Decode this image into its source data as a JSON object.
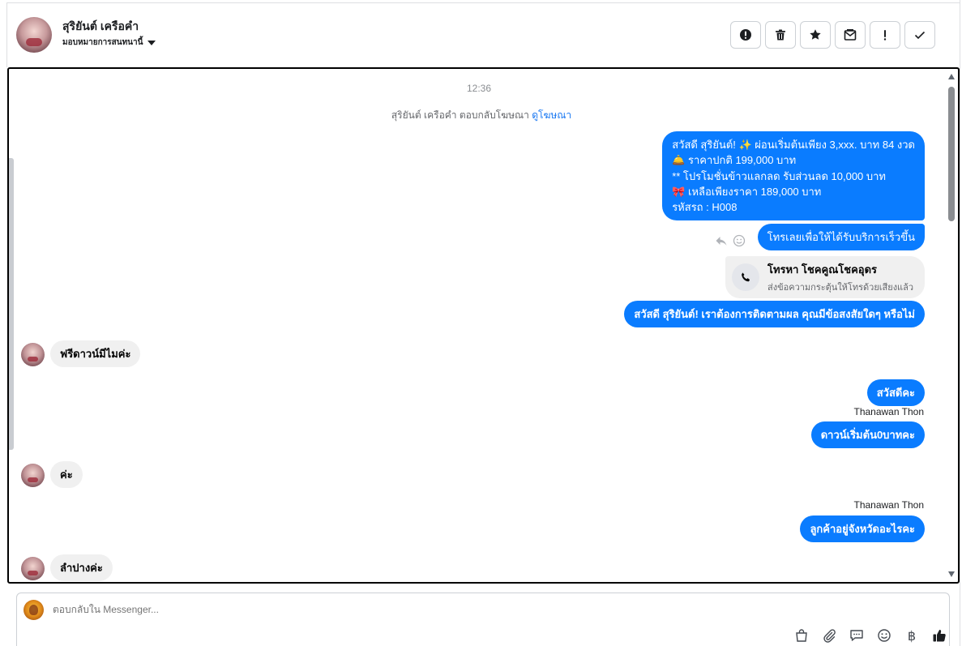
{
  "header": {
    "contact_name": "สุริยันต์ เครือคำ",
    "assign_label": "มอบหมายการสนทนานี้",
    "actions": [
      {
        "icon": "alert-circle-icon",
        "label": "spam"
      },
      {
        "icon": "trash-icon",
        "label": "delete"
      },
      {
        "icon": "star-icon",
        "label": "star"
      },
      {
        "icon": "mark-unread-icon",
        "label": "unread"
      },
      {
        "icon": "exclamation-icon",
        "label": "follow-up"
      },
      {
        "icon": "check-icon",
        "label": "done"
      }
    ]
  },
  "conversation": {
    "timestamp": "12:36",
    "ad_reply_text": "สุริยันต์ เครือคำ ตอบกลับโฆษณา",
    "ad_reply_link": "ดูโฆษณา",
    "promo_lines": [
      "สวัสดี สุริยันต์! ✨  ผ่อนเริ่มต้นเพียง 3,xxx. บาท 84 งวด",
      "🛎️ ราคาปกติ 199,000 บาท",
      "** โปรโมชั่นข้าวแลกลด รับส่วนลด 10,000 บาท",
      "🎀  เหลือเพียงราคา 189,000 บาท",
      " รหัสรถ : H008"
    ],
    "call_prompt": "โทรเลยเพื่อให้ได้รับบริการเร็วขึ้น",
    "call_card": {
      "title": "โทรหา โชคคูณโชคอุดร",
      "subtitle": "ส่งข้อความกระตุ้นให้โทรด้วยเสียงแล้ว"
    },
    "followup": "สวัสดี สุริยันต์! เราต้องการติดตามผล คุณมีข้อสงสัยใดๆ หรือไม่",
    "customer_msg_1": "ฟรีดาวน์มีไมค่ะ",
    "agent_msg_1": "สวัสดีคะ",
    "agent_name_1": "Thanawan Thon",
    "agent_msg_2": "ดาวน์เริ่มต้น0บาทคะ",
    "customer_msg_2": "ค่ะ",
    "agent_name_2": "Thanawan Thon",
    "agent_msg_3": "ลูกค้าอยู่จังหวัดอะไรคะ",
    "customer_msg_3": "ลำปางค่ะ"
  },
  "composer": {
    "placeholder": "ตอบกลับใน Messenger...",
    "currency_symbol": "฿",
    "tools": [
      "shopping-bag-icon",
      "paperclip-icon",
      "saved-reply-icon",
      "emoji-icon",
      "baht-icon",
      "thumbs-up-icon"
    ]
  },
  "colors": {
    "outgoing_bubble": "#0a7cff",
    "incoming_bubble": "#f0f0f0",
    "link": "#1877f2"
  }
}
